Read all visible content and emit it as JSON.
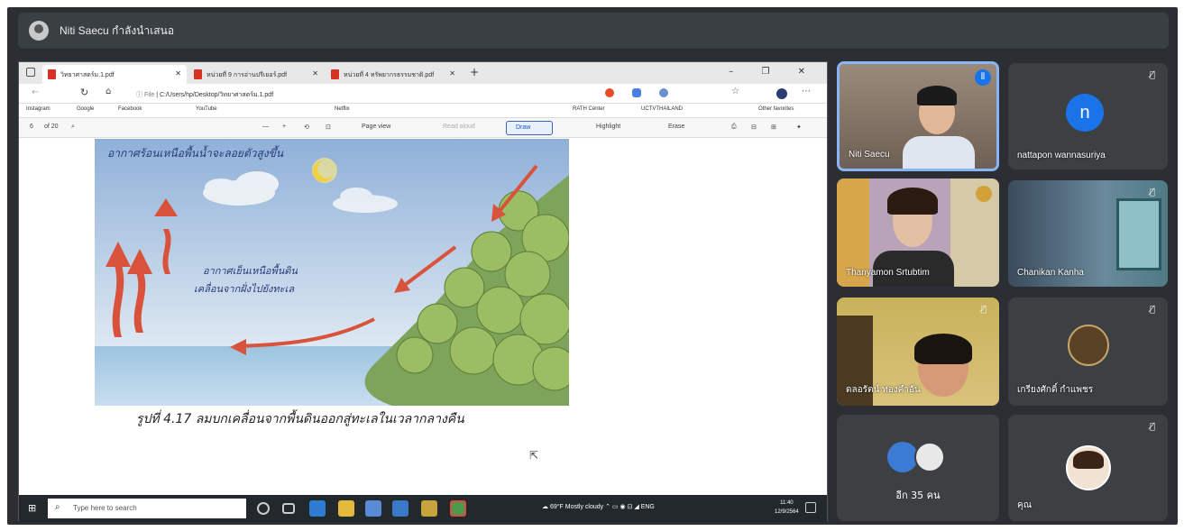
{
  "presenter": {
    "name": "Niti Saecu",
    "status": "กำลังนำเสนอ"
  },
  "browser": {
    "tabs": [
      "วิทยาศาสตร์ม.1.pdf",
      "หน่วยที่ 9 การอ่านปรีเยอร์.pdf",
      "หน่วยที่ 4 ทรัพยากรธรรมชาติ.pdf"
    ],
    "tab_add": "+",
    "window_controls": "– ❐ ✕",
    "address": "C:/Users/hp/Desktop/วิทยาศาสตร์ม.1.pdf",
    "file_label": "File",
    "bookmarks": [
      "Instagram",
      "Google",
      "Facebook",
      "YouTube",
      "Netflix",
      "RATH Center",
      "UCTVTHAILAND",
      "Other favorites"
    ],
    "page": {
      "current": "6",
      "total": "of 20"
    },
    "pdf_tools": {
      "page_view": "Page view",
      "read_aloud": "Read aloud",
      "draw": "Draw",
      "highlight": "Highlight",
      "erase": "Erase"
    }
  },
  "document": {
    "label_top": "อากาศร้อนเหนือพื้นน้ำจะลอยตัวสูงขึ้น",
    "label_middle_1": "อากาศเย็นเหนือพื้นดิน",
    "label_middle_2": "เคลื่อนจากฝั่งไปยังทะเล",
    "caption": "รูปที่ 4.17 ลมบกเคลื่อนจากพื้นดินออกสู่ทะเลในเวลากลางคืน"
  },
  "taskbar": {
    "search_placeholder": "Type here to search",
    "weather": "69°F Mostly cloudy",
    "time": "11:40",
    "date": "12/9/2564",
    "lang": "ENG"
  },
  "participants": [
    {
      "name": "Niti Saecu",
      "type": "video",
      "speaking": true
    },
    {
      "name": "nattapon wannasuriya",
      "initial": "n",
      "muted": true
    },
    {
      "name": "Thanyamon Srtubtim",
      "type": "video"
    },
    {
      "name": "Chanikan Kanha",
      "type": "video",
      "muted": true
    },
    {
      "name": "ดลอรัตน์ ทองคำอัน",
      "type": "video",
      "muted": true
    },
    {
      "name": "เกรียงศักดิ์ กำแพชร",
      "muted": true
    },
    {
      "name": "อีก 35 คน"
    },
    {
      "name": "คุณ",
      "muted": true
    }
  ],
  "colors": {
    "accent_blue": "#1a73e8",
    "avatar_n": "#1a73e8",
    "arrow_red": "#d9533c"
  }
}
